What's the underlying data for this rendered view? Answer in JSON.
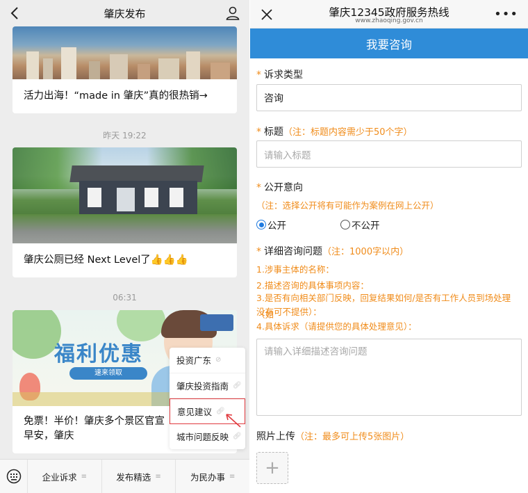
{
  "left": {
    "title": "肇庆发布",
    "articles": [
      {
        "caption": "活力出海！“made in 肇庆”真的很热销→"
      },
      {
        "timestamp": "昨天 19:22",
        "caption": "肇庆公厕已经 Next Level了👍👍👍"
      },
      {
        "timestamp": "06:31",
        "caption_line1": "免票！半价！肇庆多个景区官宣",
        "caption_line2": "早安，肇庆",
        "promo_text": "福利优惠",
        "promo_button": "速来领取"
      }
    ],
    "popup_menu": [
      {
        "label": "投资广东"
      },
      {
        "label": "肇庆投资指南"
      },
      {
        "label": "意见建议"
      },
      {
        "label": "城市问题反映"
      }
    ],
    "bottom_tabs": [
      {
        "label": "企业诉求"
      },
      {
        "label": "发布精选"
      },
      {
        "label": "为民办事"
      }
    ]
  },
  "right": {
    "title": "肇庆12345政府服务热线",
    "url": "www.zhaoqing.gov.cn",
    "header": "我要咨询",
    "fields": {
      "type_label": "诉求类型",
      "type_value": "咨询",
      "title_label": "标题",
      "title_note": "（注：标题内容需少于50个字）",
      "title_placeholder": "请输入标题",
      "public_label": "公开意向",
      "public_note": "（注：选择公开将有可能作为案例在网上公开）",
      "public_yes": "公开",
      "public_no": "不公开",
      "detail_label": "详细咨询问题",
      "detail_note": "（注：1000字以内）",
      "detail_hints": [
        "1.涉事主体的名称：",
        "2.描述咨询的具体事项内容：",
        "3.是否有向相关部门反映，回复结果如何/是否有工作人员到场处理（如",
        "没有可不提供）：",
        "4.具体诉求（请提供您的具体处理意见）："
      ],
      "detail_placeholder": "请输入详细描述咨询问题",
      "photo_label": "照片上传",
      "photo_note": "（注：最多可上传5张图片）"
    },
    "required_mark": "*"
  },
  "colors": {
    "accent_blue": "#2f8cd8",
    "note_orange": "#f08c1b",
    "highlight_red": "#e0393e"
  }
}
